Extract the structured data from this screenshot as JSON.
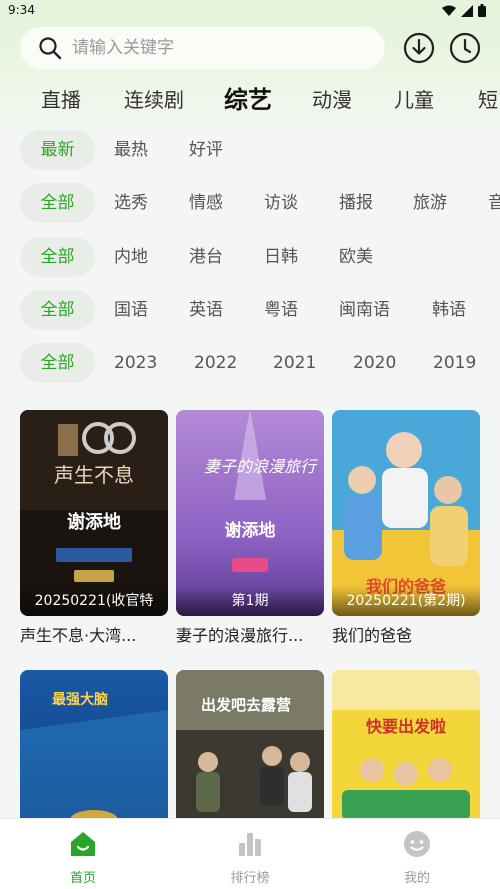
{
  "status_bar": {
    "time": "9:34"
  },
  "search": {
    "placeholder": "请输入关键字"
  },
  "channel_tabs": [
    {
      "label": "直播"
    },
    {
      "label": "连续剧"
    },
    {
      "label": "综艺",
      "active": true
    },
    {
      "label": "动漫"
    },
    {
      "label": "儿童"
    },
    {
      "label": "短"
    }
  ],
  "filters": {
    "sort": [
      "最新",
      "最热",
      "好评"
    ],
    "genre": [
      "全部",
      "选秀",
      "情感",
      "访谈",
      "播报",
      "旅游",
      "音"
    ],
    "region": [
      "全部",
      "内地",
      "港台",
      "日韩",
      "欧美"
    ],
    "language": [
      "全部",
      "国语",
      "英语",
      "粤语",
      "闽南语",
      "韩语"
    ],
    "year": [
      "全部",
      "2023",
      "2022",
      "2021",
      "2020",
      "2019"
    ]
  },
  "cards": [
    {
      "title": "声生不息·大湾...",
      "badge": "20250221(收官特",
      "poster_text": "声生不息",
      "sponsor": "谢添地"
    },
    {
      "title": "妻子的浪漫旅行...",
      "badge": "第1期",
      "poster_text": "妻子的浪漫旅行",
      "sponsor": "谢添地"
    },
    {
      "title": "我们的爸爸",
      "badge": "20250221(第2期)",
      "poster_text": "我们的爸爸"
    },
    {
      "title": "",
      "badge": "",
      "poster_text": "最强大脑"
    },
    {
      "title": "",
      "badge": "",
      "poster_text": "出发吧去露营"
    },
    {
      "title": "",
      "badge": "",
      "poster_text": "快要出发啦"
    }
  ],
  "bottom_nav": [
    {
      "label": "首页",
      "active": true
    },
    {
      "label": "排行榜"
    },
    {
      "label": "我的"
    }
  ],
  "colors": {
    "accent": "#2aa52a",
    "chip_bg": "#e9ede7"
  }
}
